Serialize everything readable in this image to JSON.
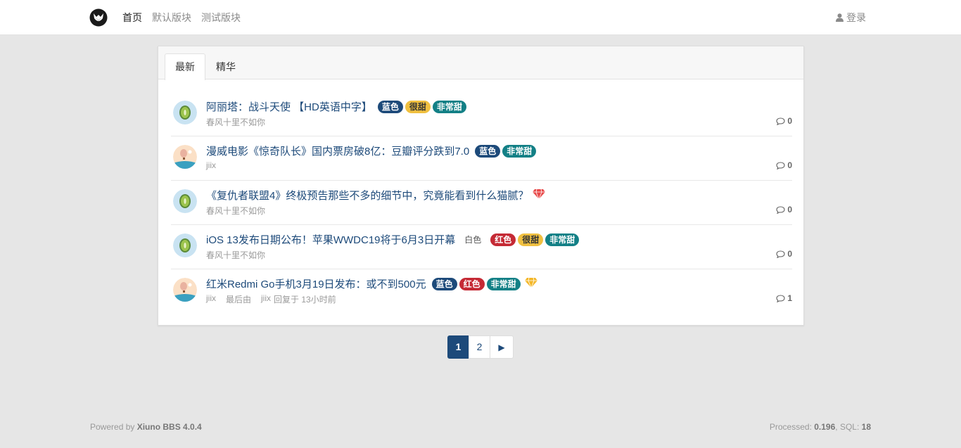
{
  "nav": {
    "links": [
      "首页",
      "默认版块",
      "测试版块"
    ],
    "login": "登录"
  },
  "tabs": [
    "最新",
    "精华"
  ],
  "threads": [
    {
      "title": "阿丽塔：战斗天使 【HD英语中字】",
      "author": "春风十里不如你",
      "replies": "0",
      "avatar": "kiwi",
      "tags": [
        {
          "label": "蓝色",
          "color": "#1d4a7a"
        },
        {
          "label": "很甜",
          "color": "#f0c040"
        },
        {
          "label": "非常甜",
          "color": "#138086"
        }
      ]
    },
    {
      "title": "漫威电影《惊奇队长》国内票房破8亿：豆瓣评分跌到7.0",
      "author": "jiix",
      "replies": "0",
      "avatar": "balloon",
      "tags": [
        {
          "label": "蓝色",
          "color": "#1d4a7a"
        },
        {
          "label": "非常甜",
          "color": "#138086"
        }
      ]
    },
    {
      "title": "《复仇者联盟4》终极预告那些不多的细节中，究竟能看到什么猫腻？",
      "author": "春风十里不如你",
      "replies": "0",
      "avatar": "kiwi",
      "gem": "red-diamond-icon"
    },
    {
      "title": "iOS 13发布日期公布！苹果WWDC19将于6月3日开幕",
      "author": "春风十里不如你",
      "replies": "0",
      "avatar": "kiwi",
      "plain_tag": "白色",
      "tags": [
        {
          "label": "红色",
          "color": "#c52a35"
        },
        {
          "label": "很甜",
          "color": "#f0c040"
        },
        {
          "label": "非常甜",
          "color": "#138086"
        }
      ]
    },
    {
      "title": "红米Redmi Go手机3月19日发布：或不到500元",
      "author": "jiix",
      "last_prefix": "最后由",
      "last_user": "jiix",
      "last_time": "回复于 13小时前",
      "replies": "1",
      "avatar": "balloon",
      "gem": "yellow-diamond-icon",
      "tags": [
        {
          "label": "蓝色",
          "color": "#1d4a7a"
        },
        {
          "label": "红色",
          "color": "#c52a35"
        },
        {
          "label": "非常甜",
          "color": "#138086"
        }
      ]
    }
  ],
  "pagination": {
    "pages": [
      "1",
      "2"
    ],
    "current": "1",
    "next": "▶"
  },
  "footer": {
    "powered_prefix": "Powered by ",
    "powered_name": "Xiuno BBS 4.0.4",
    "processed_prefix": "Processed: ",
    "processed_value": "0.196",
    "sql_prefix": ", SQL: ",
    "sql_value": "18"
  }
}
